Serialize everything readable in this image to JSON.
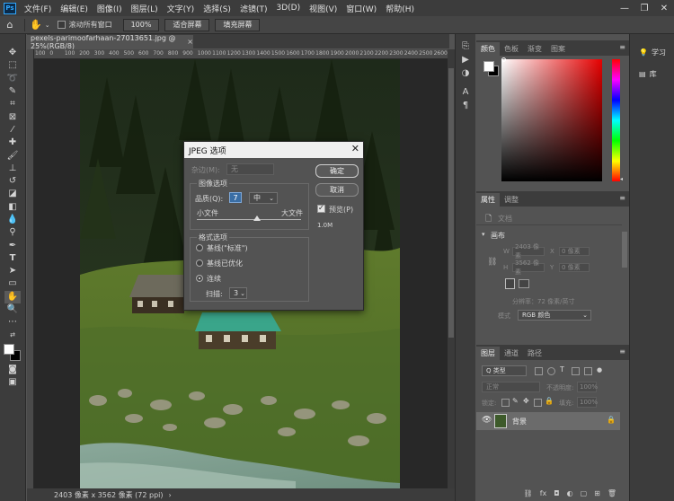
{
  "menubar": {
    "logo": "Ps",
    "items": [
      "文件(F)",
      "编辑(E)",
      "图像(I)",
      "图层(L)",
      "文字(Y)",
      "选择(S)",
      "滤镜(T)",
      "3D(D)",
      "视图(V)",
      "窗口(W)",
      "帮助(H)"
    ],
    "window_controls": [
      "—",
      "❐",
      "✕"
    ]
  },
  "optionsbar": {
    "scroll_all_label": "滚动所有窗口",
    "zoom_value": "100%",
    "fit_screen_label": "适合屏幕",
    "fill_screen_label": "填充屏幕"
  },
  "document": {
    "tab_title": "pexels-parimoofarhaan-27013651.jpg @ 25%(RGB/8)",
    "tab_close": "×",
    "ruler_ticks": [
      "100",
      "0",
      "100",
      "200",
      "300",
      "400",
      "500",
      "600",
      "700",
      "800",
      "900",
      "1000",
      "1100",
      "1200",
      "1300",
      "1400",
      "1500",
      "1600",
      "1700",
      "1800",
      "1900",
      "2000",
      "2100",
      "2200",
      "2300",
      "2400",
      "2500",
      "2600"
    ],
    "status": "2403 像素 x 3562 像素 (72 ppi)"
  },
  "dialog": {
    "title": "JPEG 选项",
    "close": "✕",
    "matte_label": "杂边(M):",
    "matte_value": "无",
    "image_options_label": "图像选项",
    "quality_label": "品质(Q):",
    "quality_value": "7",
    "quality_level": "中",
    "small_file_label": "小文件",
    "large_file_label": "大文件",
    "quality_slider_fraction": 0.58,
    "format_options_label": "格式选项",
    "format_options": [
      {
        "label": "基线(\"标准\")",
        "selected": false
      },
      {
        "label": "基线已优化",
        "selected": false
      },
      {
        "label": "连续",
        "selected": true
      }
    ],
    "scans_label": "扫描:",
    "scans_value": "3",
    "ok_label": "确定",
    "cancel_label": "取消",
    "preview_label": "预览(P)",
    "preview_checked": true,
    "file_size": "1.0M"
  },
  "panels": {
    "color_tabs": [
      "颜色",
      "色板",
      "渐变",
      "图案"
    ],
    "properties_tabs": [
      "属性",
      "调整"
    ],
    "doc_label": "文档",
    "canvas_section": "画布",
    "w_label": "W",
    "w_value": "2403 像素",
    "h_label": "H",
    "h_value": "3562 像素",
    "x_label": "X",
    "x_value": "0 像素",
    "y_label": "Y",
    "y_value": "0 像素",
    "resolution": "分辨率：72 像素/英寸",
    "mode_label": "模式",
    "mode_value": "RGB 颜色",
    "layers_tabs": [
      "图层",
      "通道",
      "路径"
    ],
    "layer_filter": "Q 类型",
    "blend_mode": "正常",
    "opacity_label": "不透明度:",
    "opacity_value": "100%",
    "lock_label": "锁定:",
    "fill_label": "填充:",
    "fill_value": "100%",
    "layer_name": "背景",
    "right_strip": [
      "学习",
      "库"
    ]
  },
  "colors": {
    "foreground": "#ffffff",
    "background": "#000000",
    "accent": "#31a8ff",
    "roof_teal": "#3aa58a"
  }
}
